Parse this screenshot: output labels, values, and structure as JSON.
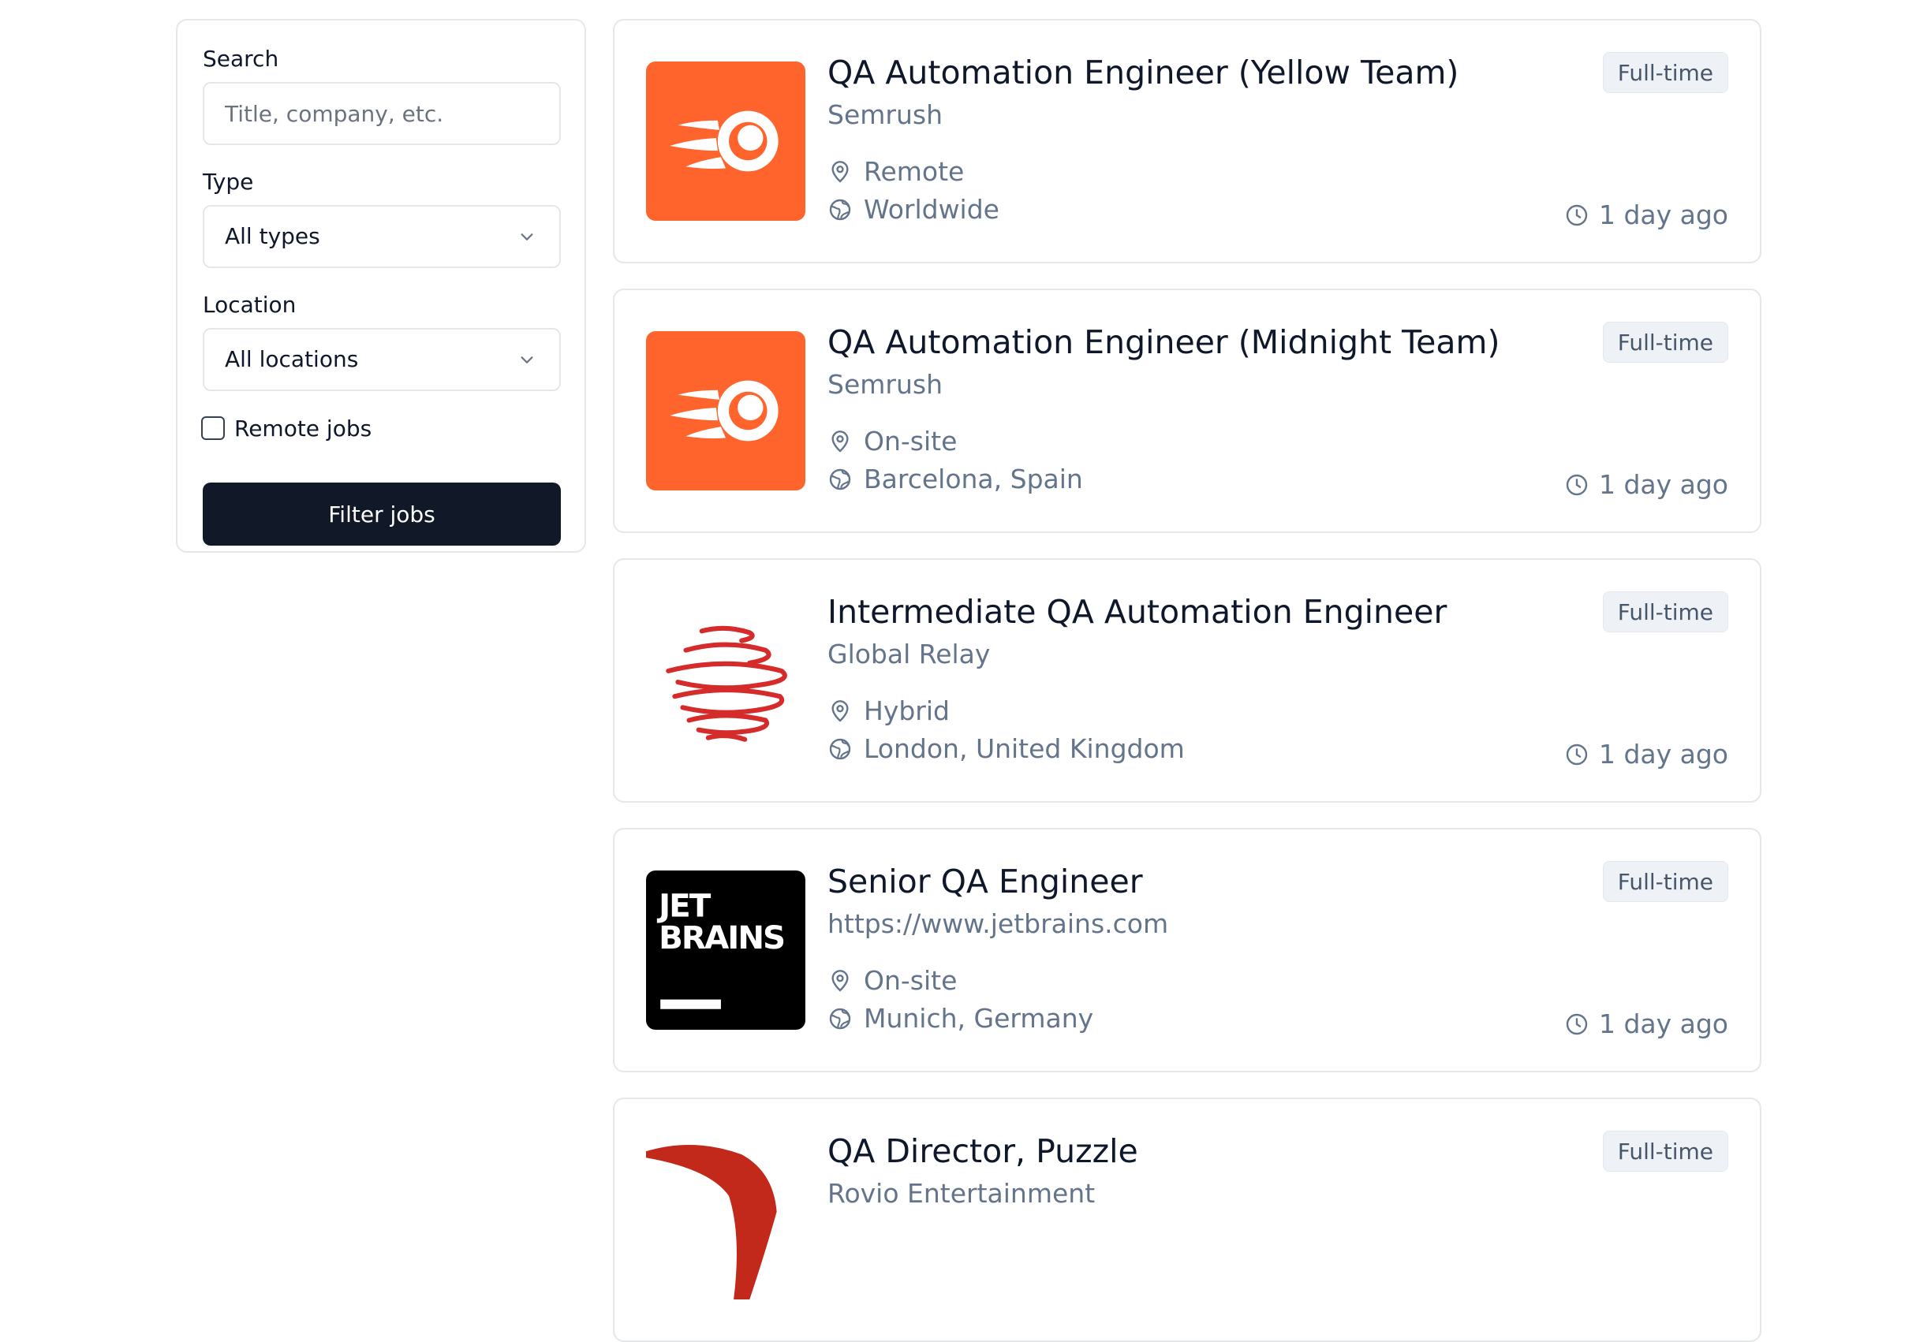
{
  "filters": {
    "search_label": "Search",
    "search_placeholder": "Title, company, etc.",
    "type_label": "Type",
    "type_value": "All types",
    "location_label": "Location",
    "location_value": "All locations",
    "remote_label": "Remote jobs",
    "remote_checked": false,
    "filter_button": "Filter jobs"
  },
  "jobs": [
    {
      "title": "QA Automation Engineer (Yellow Team)",
      "company": "Semrush",
      "work_mode": "Remote",
      "location": "Worldwide",
      "type": "Full-time",
      "posted": "1 day ago",
      "logo": "semrush-logo"
    },
    {
      "title": "QA Automation Engineer (Midnight Team)",
      "company": "Semrush",
      "work_mode": "On-site",
      "location": "Barcelona, Spain",
      "type": "Full-time",
      "posted": "1 day ago",
      "logo": "semrush-logo"
    },
    {
      "title": "Intermediate QA Automation Engineer",
      "company": "Global Relay",
      "work_mode": "Hybrid",
      "location": "London, United Kingdom",
      "type": "Full-time",
      "posted": "1 day ago",
      "logo": "global-relay-logo"
    },
    {
      "title": "Senior QA Engineer",
      "company": "https://www.jetbrains.com",
      "work_mode": "On-site",
      "location": "Munich, Germany",
      "type": "Full-time",
      "posted": "1 day ago",
      "logo": "jetbrains-logo",
      "logo_text": [
        "JET",
        "BRAINS"
      ]
    },
    {
      "title": "QA Director, Puzzle",
      "company": "Rovio Entertainment",
      "type": "Full-time",
      "logo": "rovio-logo"
    }
  ],
  "icons": {
    "work_mode": "map-pin-icon",
    "location": "globe-icon",
    "posted": "clock-icon",
    "select": "chevron-down-icon"
  },
  "colors": {
    "semrush_orange": "#ff642d",
    "global_relay_red": "#d52b2b",
    "jetbrains_black": "#000000",
    "rovio_red": "#c3291b",
    "button_dark": "#111827",
    "badge_bg": "#eef2f6"
  }
}
